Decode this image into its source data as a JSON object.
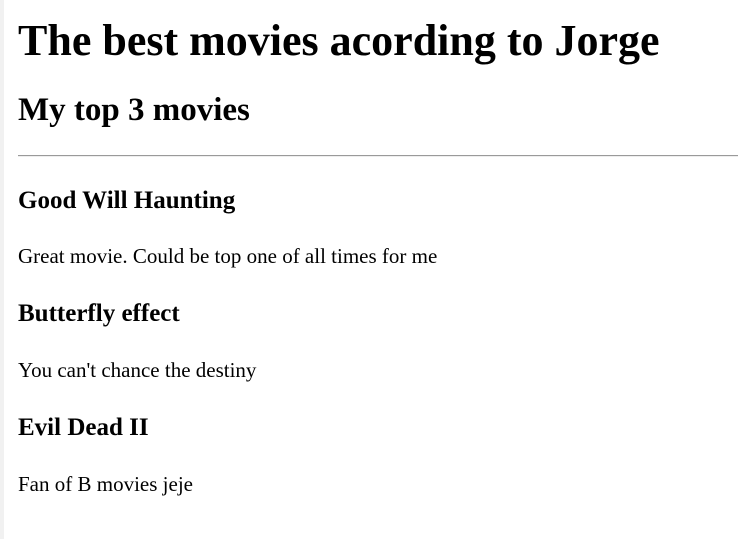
{
  "page": {
    "title": "The best movies acording to Jorge",
    "subtitle": "My top 3 movies"
  },
  "movies": [
    {
      "title": "Good Will Haunting",
      "description": "Great movie. Could be top one of all times for me"
    },
    {
      "title": "Butterfly effect",
      "description": "You can't chance the destiny"
    },
    {
      "title": "Evil Dead II",
      "description": "Fan of B movies jeje"
    }
  ]
}
